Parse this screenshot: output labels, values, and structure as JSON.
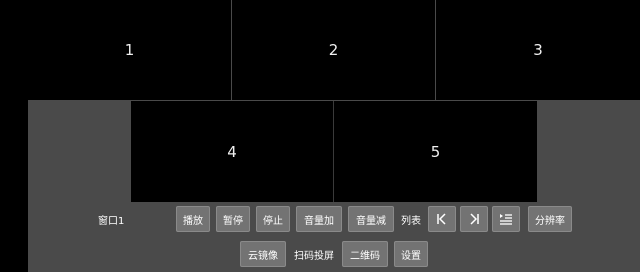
{
  "cells": [
    {
      "label": "1"
    },
    {
      "label": "2"
    },
    {
      "label": "3"
    },
    {
      "label": "4"
    },
    {
      "label": "5"
    }
  ],
  "controls": {
    "window_select": "窗口1",
    "play": "播放",
    "pause": "暂停",
    "stop": "停止",
    "volume_up": "音量加",
    "volume_down": "音量减",
    "list": "列表",
    "resolution": "分辨率",
    "cloud_mirror": "云镜像",
    "scan_cast": "扫码投屏",
    "qr_code": "二维码",
    "settings": "设置"
  },
  "icons": {
    "previous": "skip-previous-icon",
    "next": "skip-next-icon",
    "playlist": "playlist-icon",
    "dropdown": "caret-down-icon"
  },
  "colors": {
    "background": "#000000",
    "panel": "#4a4a4a",
    "button": "#737373",
    "text": "#ffffff"
  }
}
